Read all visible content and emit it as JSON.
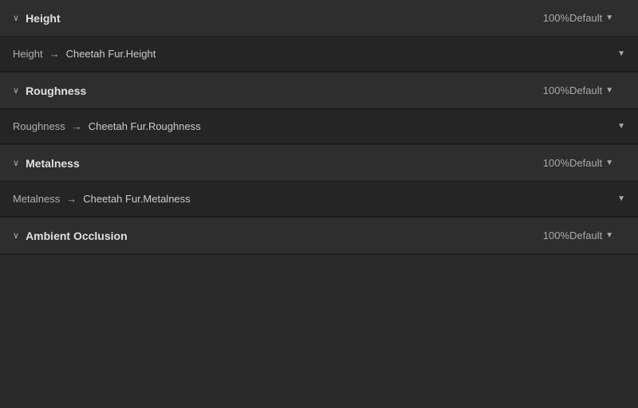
{
  "sections": [
    {
      "id": "height",
      "title": "Height",
      "percent": "100%",
      "default_label": "Default",
      "row_label": "Height",
      "row_value": "Cheetah Fur.Height"
    },
    {
      "id": "roughness",
      "title": "Roughness",
      "percent": "100%",
      "default_label": "Default",
      "row_label": "Roughness",
      "row_value": "Cheetah Fur.Roughness"
    },
    {
      "id": "metalness",
      "title": "Metalness",
      "percent": "100%",
      "default_label": "Default",
      "row_label": "Metalness",
      "row_value": "Cheetah Fur.Metalness"
    },
    {
      "id": "ambient-occlusion",
      "title": "Ambient Occlusion",
      "percent": "100%",
      "default_label": "Default",
      "row_label": null,
      "row_value": null
    }
  ],
  "icons": {
    "chevron_down": "∨",
    "arrow_right": "→",
    "dropdown_arrow": "▼"
  }
}
